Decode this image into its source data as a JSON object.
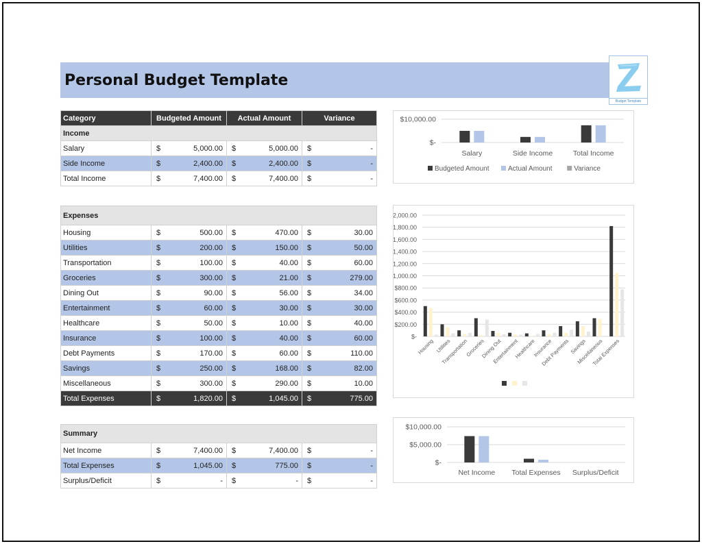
{
  "title": "Personal Budget Template",
  "logo": {
    "letter": "Z",
    "caption": "Budget Template"
  },
  "colors": {
    "title_band": "#b4c6e7",
    "header_dark": "#3a3a3a",
    "row_blue": "#b4c6e7",
    "section_gray": "#e4e4e4",
    "series_budgeted": "#3a3a3a",
    "series_actual_income": "#b4c6e7",
    "series_actual_expenses": "#fff2cc",
    "series_variance": "#d9d9d9"
  },
  "columns": [
    "Category",
    "Budgeted Amount",
    "Actual Amount",
    "Variance"
  ],
  "currency": "$",
  "income": {
    "section_label": "Income",
    "rows": [
      {
        "category": "Salary",
        "budgeted": "5,000.00",
        "actual": "5,000.00",
        "variance": "-"
      },
      {
        "category": "Side Income",
        "budgeted": "2,400.00",
        "actual": "2,400.00",
        "variance": "-"
      },
      {
        "category": "Total Income",
        "budgeted": "7,400.00",
        "actual": "7,400.00",
        "variance": "-"
      }
    ]
  },
  "expenses": {
    "section_label": "Expenses",
    "rows": [
      {
        "category": "Housing",
        "budgeted": "500.00",
        "actual": "470.00",
        "variance": "30.00"
      },
      {
        "category": "Utilities",
        "budgeted": "200.00",
        "actual": "150.00",
        "variance": "50.00"
      },
      {
        "category": "Transportation",
        "budgeted": "100.00",
        "actual": "40.00",
        "variance": "60.00"
      },
      {
        "category": "Groceries",
        "budgeted": "300.00",
        "actual": "21.00",
        "variance": "279.00"
      },
      {
        "category": "Dining Out",
        "budgeted": "90.00",
        "actual": "56.00",
        "variance": "34.00"
      },
      {
        "category": "Entertainment",
        "budgeted": "60.00",
        "actual": "30.00",
        "variance": "30.00"
      },
      {
        "category": "Healthcare",
        "budgeted": "50.00",
        "actual": "10.00",
        "variance": "40.00"
      },
      {
        "category": "Insurance",
        "budgeted": "100.00",
        "actual": "40.00",
        "variance": "60.00"
      },
      {
        "category": "Debt Payments",
        "budgeted": "170.00",
        "actual": "60.00",
        "variance": "110.00"
      },
      {
        "category": "Savings",
        "budgeted": "250.00",
        "actual": "168.00",
        "variance": "82.00"
      },
      {
        "category": "Miscellaneous",
        "budgeted": "300.00",
        "actual": "290.00",
        "variance": "10.00"
      }
    ],
    "total": {
      "category": "Total Expenses",
      "budgeted": "1,820.00",
      "actual": "1,045.00",
      "variance": "775.00"
    }
  },
  "summary": {
    "section_label": "Summary",
    "rows": [
      {
        "category": "Net Income",
        "budgeted": "7,400.00",
        "actual": "7,400.00",
        "variance": "-"
      },
      {
        "category": "Total Expenses",
        "budgeted": "1,045.00",
        "actual": "775.00",
        "variance": "-"
      },
      {
        "category": "Surplus/Deficit",
        "budgeted": "-",
        "actual": "-",
        "variance": "-"
      }
    ]
  },
  "chart_data": [
    {
      "id": "income-chart",
      "type": "bar",
      "categories": [
        "Salary",
        "Side Income",
        "Total Income"
      ],
      "series": [
        {
          "name": "Budgeted Amount",
          "color": "#3a3a3a",
          "values": [
            5000,
            2400,
            7400
          ]
        },
        {
          "name": "Actual Amount",
          "color": "#b4c6e7",
          "values": [
            5000,
            2400,
            7400
          ]
        },
        {
          "name": "Variance",
          "color": "#a6a6a6",
          "values": [
            0,
            0,
            0
          ]
        }
      ],
      "yticks": [
        {
          "value": 0,
          "label": "$-"
        },
        {
          "value": 10000,
          "label": "$10,000.00"
        }
      ],
      "ylim": [
        0,
        10000
      ],
      "legend": "bottom",
      "grid": true
    },
    {
      "id": "expenses-chart",
      "type": "bar",
      "categories": [
        "Housing",
        "Utilities",
        "Transportation",
        "Groceries",
        "Dining Out",
        "Entertainment",
        "Healthcare",
        "Insurance",
        "Debt Payments",
        "Savings",
        "Miscellaneous",
        "Total Expenses"
      ],
      "series": [
        {
          "name": "",
          "color": "#3a3a3a",
          "values": [
            500,
            200,
            100,
            300,
            90,
            60,
            50,
            100,
            170,
            250,
            300,
            1820
          ]
        },
        {
          "name": "",
          "color": "#fff2cc",
          "values": [
            470,
            150,
            40,
            21,
            56,
            30,
            10,
            40,
            60,
            168,
            290,
            1045
          ]
        },
        {
          "name": "",
          "color": "#e7e6e6",
          "values": [
            30,
            50,
            60,
            279,
            34,
            30,
            40,
            60,
            110,
            82,
            10,
            775
          ]
        }
      ],
      "yticks": [
        {
          "value": 0,
          "label": "$-"
        },
        {
          "value": 200,
          "label": "$200.00"
        },
        {
          "value": 400,
          "label": "$400.00"
        },
        {
          "value": 600,
          "label": "$600.00"
        },
        {
          "value": 800,
          "label": "$800.00"
        },
        {
          "value": 1000,
          "label": "$1,000.00"
        },
        {
          "value": 1200,
          "label": "$1,200.00"
        },
        {
          "value": 1400,
          "label": "$1,400.00"
        },
        {
          "value": 1600,
          "label": "$1,600.00"
        },
        {
          "value": 1800,
          "label": "$1,800.00"
        },
        {
          "value": 2000,
          "label": "$2,000.00"
        }
      ],
      "ylim": [
        0,
        2000
      ],
      "legend": "bottom",
      "grid": true
    },
    {
      "id": "summary-chart",
      "type": "bar",
      "categories": [
        "Net Income",
        "Total Expenses",
        "Surplus/Deficit"
      ],
      "series": [
        {
          "name": "Budgeted Amount",
          "color": "#3a3a3a",
          "values": [
            7400,
            1045,
            0
          ]
        },
        {
          "name": "Actual Amount",
          "color": "#b4c6e7",
          "values": [
            7400,
            775,
            0
          ]
        }
      ],
      "yticks": [
        {
          "value": 0,
          "label": "$-"
        },
        {
          "value": 5000,
          "label": "$5,000.00"
        },
        {
          "value": 10000,
          "label": "$10,000.00"
        }
      ],
      "ylim": [
        0,
        10000
      ],
      "legend": "none",
      "grid": true
    }
  ]
}
